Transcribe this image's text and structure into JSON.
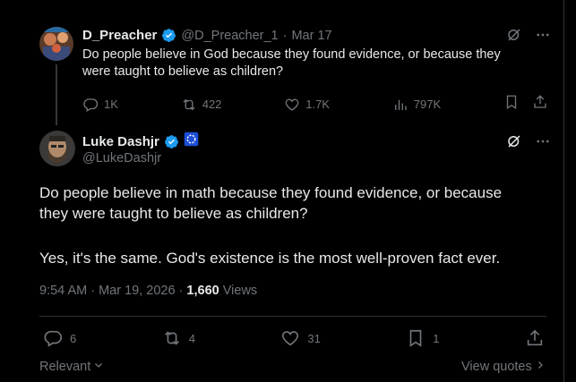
{
  "quoted": {
    "display_name": "D_Preacher",
    "handle": "@D_Preacher_1",
    "separator": "·",
    "date": "Mar 17",
    "text_line1": "Do people believe in God because they found evidence, or because they",
    "text_line2": "were taught to believe as children?",
    "replies": "1K",
    "reposts": "422",
    "likes": "1.7K",
    "views": "797K"
  },
  "main": {
    "display_name": "Luke Dashjr",
    "handle": "@LukeDashjr",
    "text_line1": "Do people believe in math because they found evidence, or because",
    "text_line2": "they were taught to believe as children?",
    "text_line3": "Yes, it's the same. God's existence is the most well-proven fact ever.",
    "time": "9:54 AM · Mar 19, 2026 · ",
    "view_count": "1,660",
    "views_label": " Views",
    "replies": "6",
    "reposts": "4",
    "likes": "31",
    "bookmarks": "1"
  },
  "footer": {
    "sort_label": "Relevant",
    "view_quotes": "View quotes"
  },
  "colors": {
    "background": "#000000",
    "text": "#e7e9ea",
    "muted": "#71767b",
    "verified": "#1d9bf0",
    "divider": "#2f3336"
  }
}
